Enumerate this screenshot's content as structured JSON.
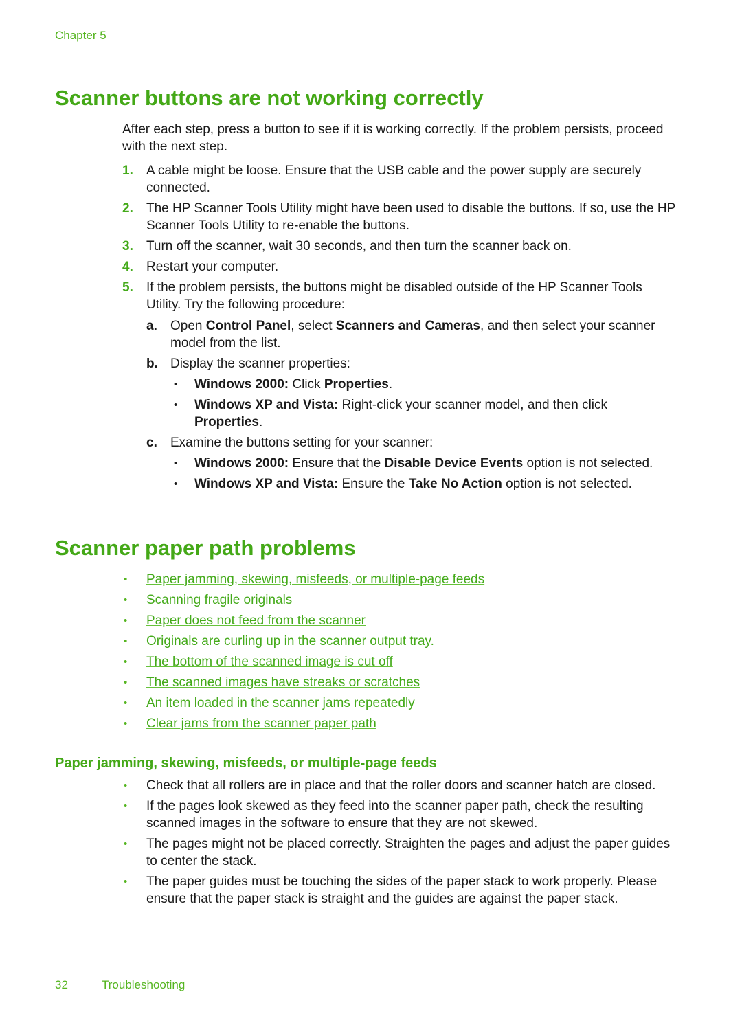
{
  "header": {
    "chapter": "Chapter 5"
  },
  "section1": {
    "title": "Scanner buttons are not working correctly",
    "intro": "After each step, press a button to see if it is working correctly. If the problem persists, proceed with the next step.",
    "steps": [
      {
        "num": "1.",
        "text": "A cable might be loose. Ensure that the USB cable and the power supply are securely connected."
      },
      {
        "num": "2.",
        "text": "The HP Scanner Tools Utility might have been used to disable the buttons. If so, use the HP  Scanner Tools Utility to re-enable the buttons."
      },
      {
        "num": "3.",
        "text": "Turn off the scanner, wait 30 seconds, and then turn the scanner back on."
      },
      {
        "num": "4.",
        "text": "Restart your computer."
      },
      {
        "num": "5.",
        "text": "If the problem persists, the buttons might be disabled outside of the HP Scanner Tools Utility. Try the following procedure:"
      }
    ],
    "substeps": {
      "a": {
        "label": "a.",
        "t1": "Open ",
        "b1": "Control Panel",
        "t2": ", select ",
        "b2": "Scanners and Cameras",
        "t3": ", and then select your scanner model from the list."
      },
      "b": {
        "label": "b.",
        "text": "Display the scanner properties:",
        "bullets": [
          {
            "b1": "Windows 2000:",
            "t1": " Click ",
            "b2": "Properties",
            "t2": "."
          },
          {
            "b1": "Windows XP and Vista:",
            "t1": " Right-click your scanner model, and then click ",
            "b2": "Properties",
            "t2": "."
          }
        ]
      },
      "c": {
        "label": "c.",
        "text": "Examine the buttons setting for your scanner:",
        "bullets": [
          {
            "b1": "Windows 2000:",
            "t1": " Ensure that the ",
            "b2": "Disable Device Events",
            "t2": " option is not selected."
          },
          {
            "b1": "Windows XP and Vista:",
            "t1": " Ensure the ",
            "b2": "Take No Action",
            "t2": " option is not selected."
          }
        ]
      }
    }
  },
  "section2": {
    "title": "Scanner paper path problems",
    "links": [
      "Paper jamming, skewing, misfeeds, or multiple-page feeds",
      "Scanning fragile originals",
      "Paper does not feed from the scanner",
      "Originals are curling up in the scanner output tray.",
      "The bottom of the scanned image is cut off",
      "The scanned images have streaks or scratches",
      "An item loaded in the scanner jams repeatedly",
      "Clear jams from the scanner paper path"
    ]
  },
  "section3": {
    "title": "Paper jamming, skewing, misfeeds, or multiple-page feeds",
    "tips": [
      "Check that all rollers are in place and that the roller doors and scanner hatch are closed.",
      "If the pages look skewed as they feed into the scanner paper path, check the resulting scanned images in the software to ensure that they are not skewed.",
      "The pages might not be placed correctly. Straighten the pages and adjust the paper guides to center the stack.",
      "The paper guides must be touching the sides of the paper stack to work properly. Please ensure that the paper stack is straight and the guides are against the paper stack."
    ]
  },
  "bullet_glyph": "•",
  "footer": {
    "page_number": "32",
    "section": "Troubleshooting"
  }
}
